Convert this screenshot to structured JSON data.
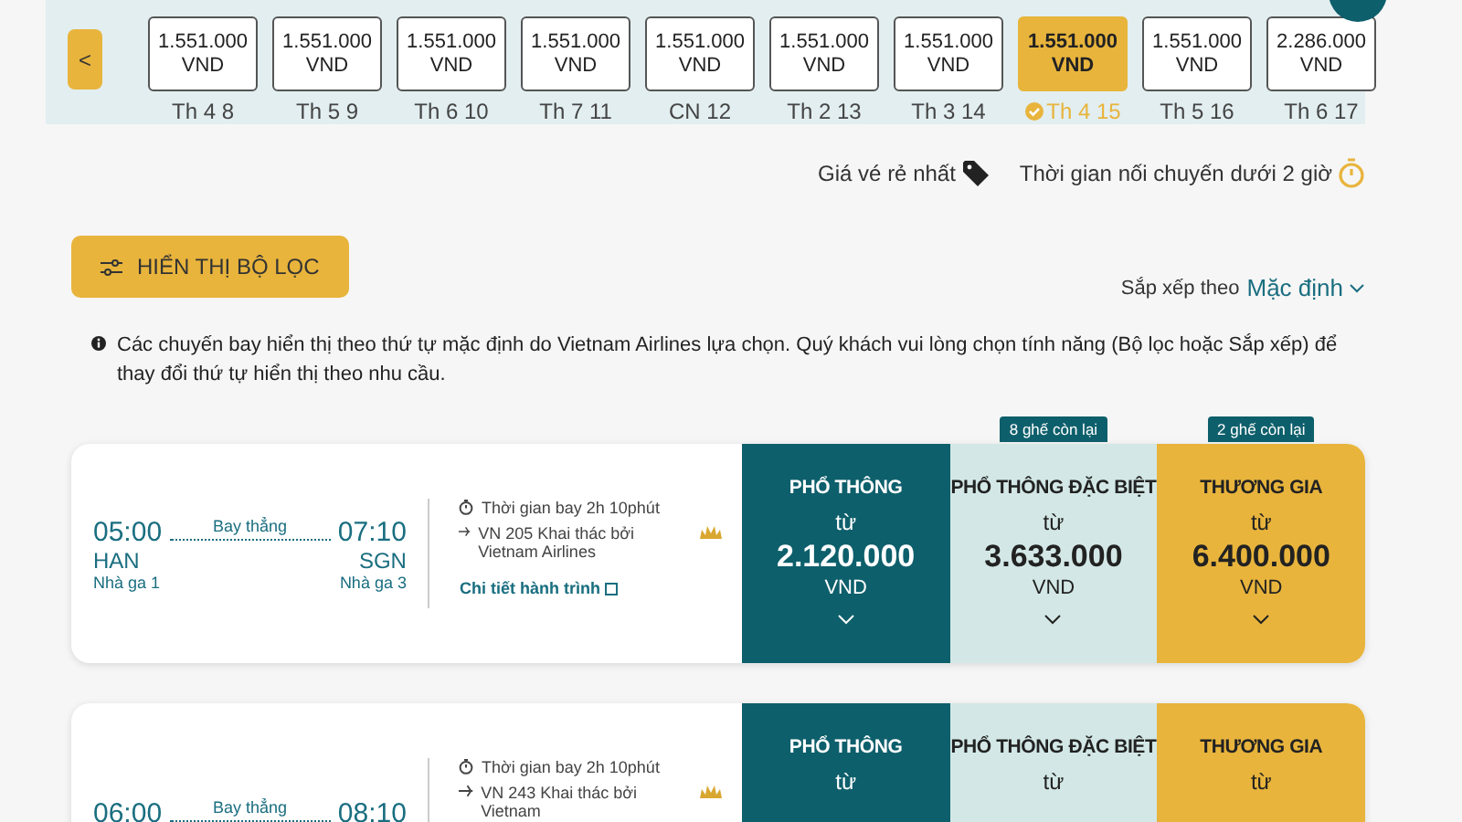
{
  "date_strip": {
    "prev_label": "<",
    "days": [
      {
        "price": "1.551.000",
        "currency": "VND",
        "label": "Th 4 8",
        "selected": false
      },
      {
        "price": "1.551.000",
        "currency": "VND",
        "label": "Th 5 9",
        "selected": false
      },
      {
        "price": "1.551.000",
        "currency": "VND",
        "label": "Th 6 10",
        "selected": false
      },
      {
        "price": "1.551.000",
        "currency": "VND",
        "label": "Th 7 11",
        "selected": false
      },
      {
        "price": "1.551.000",
        "currency": "VND",
        "label": "CN 12",
        "selected": false
      },
      {
        "price": "1.551.000",
        "currency": "VND",
        "label": "Th 2 13",
        "selected": false
      },
      {
        "price": "1.551.000",
        "currency": "VND",
        "label": "Th 3 14",
        "selected": false
      },
      {
        "price": "1.551.000",
        "currency": "VND",
        "label": "Th 4 15",
        "selected": true
      },
      {
        "price": "1.551.000",
        "currency": "VND",
        "label": "Th 5 16",
        "selected": false
      },
      {
        "price": "2.286.000",
        "currency": "VND",
        "label": "Th 6 17",
        "selected": false
      }
    ]
  },
  "legend": [
    {
      "kind": "cheapest",
      "label": "Giá vé rẻ nhất"
    },
    {
      "kind": "short-connection",
      "label": "Thời gian nối chuyến dưới 2 giờ"
    }
  ],
  "filter_button": "HIỂN THỊ BỘ LỌC",
  "sort": {
    "label": "Sắp xếp theo",
    "value": "Mặc định"
  },
  "notice": "Các chuyến bay hiển thị theo thứ tự mặc định do Vietnam Airlines lựa chọn. Quý khách vui lòng chọn tính năng (Bộ lọc hoặc Sắp xếp) để thay đổi thứ tự hiển thị theo nhu cầu.",
  "flights": [
    {
      "depart_time": "05:00",
      "arrive_time": "07:10",
      "stop_label": "Bay thẳng",
      "from": "HAN",
      "to": "SGN",
      "from_terminal": "Nhà ga 1",
      "to_terminal": "Nhà ga 3",
      "duration": "Thời gian bay 2h 10phút",
      "flight_info": "VN 205 Khai thác bởi Vietnam Airlines",
      "details_link": "Chi tiết hành trình",
      "fares": [
        {
          "kind": "economy",
          "class_name": "PHỔ THÔNG",
          "from_label": "từ",
          "price": "2.120.000",
          "currency": "VND"
        },
        {
          "kind": "premium",
          "class_name": "PHỔ THÔNG ĐẶC BIỆT",
          "from_label": "từ",
          "price": "3.633.000",
          "currency": "VND",
          "seats_left": "8 ghế còn lại"
        },
        {
          "kind": "business",
          "class_name": "THƯƠNG GIA",
          "from_label": "từ",
          "price": "6.400.000",
          "currency": "VND",
          "seats_left": "2 ghế còn lại"
        }
      ]
    },
    {
      "depart_time": "06:00",
      "arrive_time": "08:10",
      "stop_label": "Bay thẳng",
      "duration": "Thời gian bay 2h 10phút",
      "flight_info": "VN 243 Khai thác bởi Vietnam",
      "fares": [
        {
          "kind": "economy",
          "class_name": "PHỔ THÔNG",
          "from_label": "từ"
        },
        {
          "kind": "premium",
          "class_name": "PHỔ THÔNG ĐẶC BIỆT",
          "from_label": "từ"
        },
        {
          "kind": "business",
          "class_name": "THƯƠNG GIA",
          "from_label": "từ"
        }
      ]
    }
  ]
}
